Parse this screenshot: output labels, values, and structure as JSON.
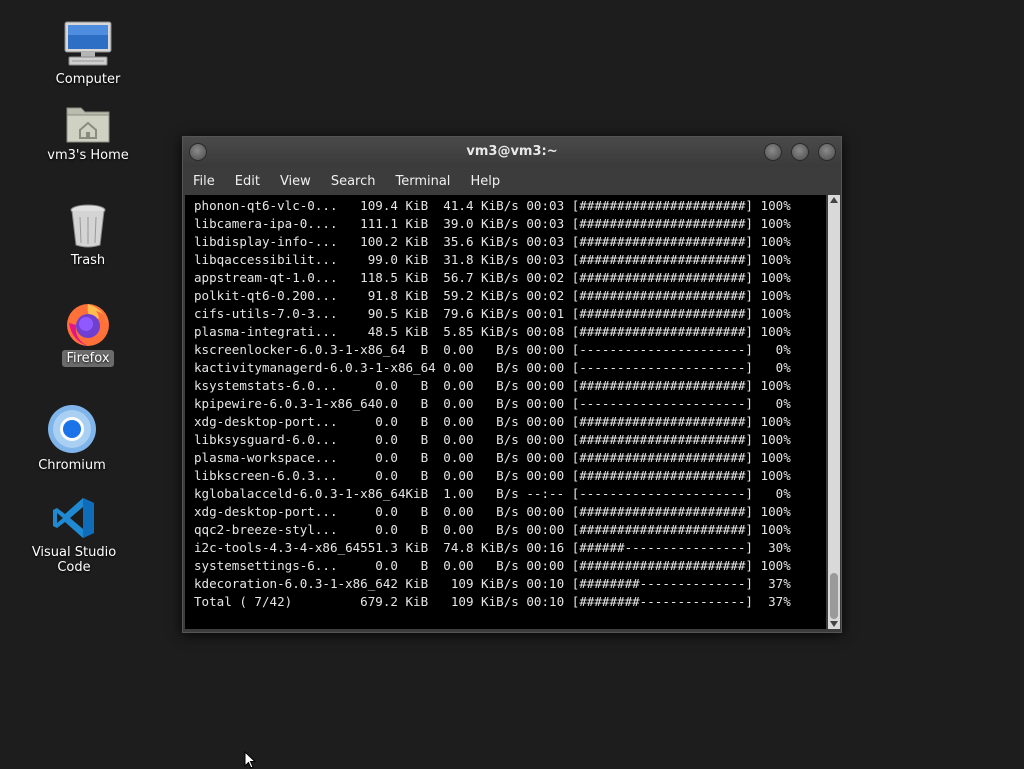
{
  "desktop": {
    "icons": [
      {
        "label": "Computer"
      },
      {
        "label": "vm3's Home"
      },
      {
        "label": "Trash"
      },
      {
        "label": "Firefox"
      },
      {
        "label": "Chromium"
      },
      {
        "label": "Visual Studio Code"
      }
    ]
  },
  "window": {
    "title": "vm3@vm3:~",
    "menu": [
      "File",
      "Edit",
      "View",
      "Search",
      "Terminal",
      "Help"
    ]
  },
  "terminal": {
    "lines": [
      "phonon-qt6-vlc-0...   109.4 KiB  41.4 KiB/s 00:03 [######################] 100%",
      "libcamera-ipa-0....   111.1 KiB  39.0 KiB/s 00:03 [######################] 100%",
      "libdisplay-info-...   100.2 KiB  35.6 KiB/s 00:03 [######################] 100%",
      "libqaccessibilit...    99.0 KiB  31.8 KiB/s 00:03 [######################] 100%",
      "appstream-qt-1.0...   118.5 KiB  56.7 KiB/s 00:02 [######################] 100%",
      "polkit-qt6-0.200...    91.8 KiB  59.2 KiB/s 00:02 [######################] 100%",
      "cifs-utils-7.0-3...    90.5 KiB  79.6 KiB/s 00:01 [######################] 100%",
      "plasma-integrati...    48.5 KiB  5.85 KiB/s 00:08 [######################] 100%",
      "kscreenlocker-6.0.3-1-x86_64  B  0.00   B/s 00:00 [----------------------]   0%",
      "kactivitymanagerd-6.0.3-1-x86_64 0.00   B/s 00:00 [----------------------]   0%",
      "ksystemstats-6.0...     0.0   B  0.00   B/s 00:00 [######################] 100%",
      "kpipewire-6.0.3-1-x86_640.0   B  0.00   B/s 00:00 [----------------------]   0%",
      "xdg-desktop-port...     0.0   B  0.00   B/s 00:00 [######################] 100%",
      "libksysguard-6.0...     0.0   B  0.00   B/s 00:00 [######################] 100%",
      "plasma-workspace...     0.0   B  0.00   B/s 00:00 [######################] 100%",
      "libkscreen-6.0.3...     0.0   B  0.00   B/s 00:00 [######################] 100%",
      "kglobalacceld-6.0.3-1-x86_64KiB  1.00   B/s --:-- [----------------------]   0%",
      "xdg-desktop-port...     0.0   B  0.00   B/s 00:00 [######################] 100%",
      "qqc2-breeze-styl...     0.0   B  0.00   B/s 00:00 [######################] 100%",
      "i2c-tools-4.3-4-x86_64551.3 KiB  74.8 KiB/s 00:16 [######----------------]  30%",
      "systemsettings-6...     0.0   B  0.00   B/s 00:00 [######################] 100%",
      "kdecoration-6.0.3-1-x86_642 KiB   109 KiB/s 00:10 [########--------------]  37%",
      "Total ( 7/42)         679.2 KiB   109 KiB/s 00:10 [########--------------]  37%"
    ]
  },
  "colors": {
    "desktop_bg": "#1d1d1d",
    "terminal_bg": "#000000",
    "terminal_fg": "#e6e6e6"
  },
  "icons": [
    "computer-icon",
    "home-folder-icon",
    "trash-icon",
    "firefox-icon",
    "chromium-icon",
    "vscode-icon"
  ]
}
